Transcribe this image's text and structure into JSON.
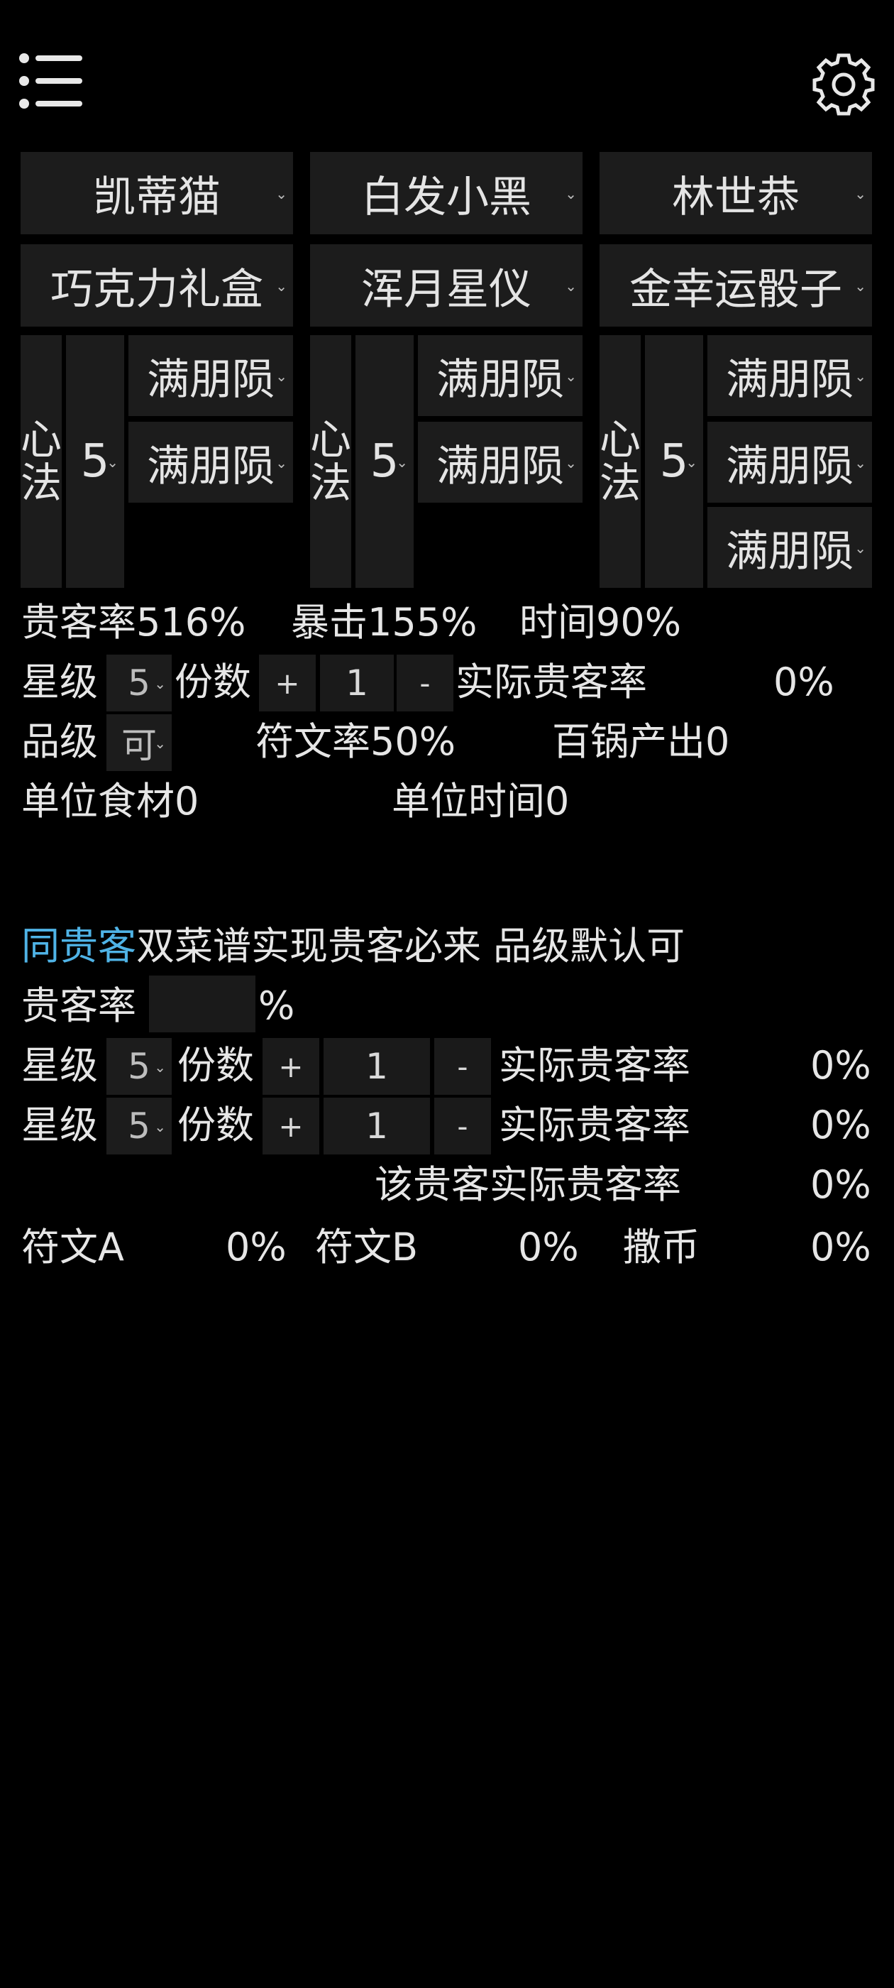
{
  "header": {
    "menu_icon": "hamburger-menu-icon",
    "settings_icon": "gear-icon"
  },
  "chef_selects": [
    "凯蒂猫",
    "白发小黑",
    "林世恭"
  ],
  "equip_selects": [
    "巧克力礼盒",
    "浑月星仪",
    "金幸运骰子"
  ],
  "columns": [
    {
      "heart_label_1": "心",
      "heart_label_2": "法",
      "level": "5",
      "slots": [
        "满朋陨",
        "满朋陨"
      ]
    },
    {
      "heart_label_1": "心",
      "heart_label_2": "法",
      "level": "5",
      "slots": [
        "满朋陨",
        "满朋陨"
      ]
    },
    {
      "heart_label_1": "心",
      "heart_label_2": "法",
      "level": "5",
      "slots": [
        "满朋陨",
        "满朋陨",
        "满朋陨"
      ]
    }
  ],
  "stats": {
    "guest_rate": "贵客率516%",
    "crit": "暴击155%",
    "time": "时间90%"
  },
  "row1": {
    "star_label": "星级",
    "star_value": "5",
    "portion_label": "份数",
    "plus": "+",
    "count": "1",
    "minus": "-",
    "actual_label": "实际贵客率",
    "actual_value": "0%"
  },
  "row2": {
    "grade_label": "品级",
    "grade_value": "可",
    "rune_rate": "符文率50%",
    "hundred_pot": "百锅产出0"
  },
  "row3": {
    "unit_ingredient": "单位食材0",
    "unit_time": "单位时间0"
  },
  "section2": {
    "highlight": "同贵客",
    "title_rest": "双菜谱实现贵客必来 品级默认可",
    "guest_rate_label": "贵客率",
    "guest_rate_input": "",
    "percent": "%",
    "recipes": [
      {
        "star_label": "星级",
        "star_value": "5",
        "portion_label": "份数",
        "plus": "+",
        "count": "1",
        "minus": "-",
        "actual_label": "实际贵客率",
        "actual_value": "0%"
      },
      {
        "star_label": "星级",
        "star_value": "5",
        "portion_label": "份数",
        "plus": "+",
        "count": "1",
        "minus": "-",
        "actual_label": "实际贵客率",
        "actual_value": "0%"
      }
    ],
    "guest_actual_label": "该贵客实际贵客率",
    "guest_actual_value": "0%",
    "rune_a_label": "符文A",
    "rune_a_value": "0%",
    "rune_b_label": "符文B",
    "rune_b_value": "0%",
    "coin_label": "撒币",
    "coin_value": "0%"
  },
  "colors": {
    "background": "#000000",
    "control": "#1c1c1c",
    "highlight": "#4fb3e6"
  }
}
